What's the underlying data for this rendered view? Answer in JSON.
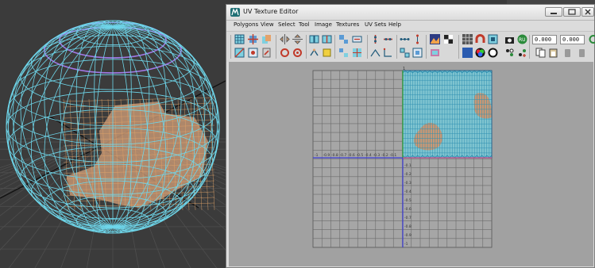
{
  "window": {
    "title": "UV Texture Editor",
    "minimize_icon": "minimize-icon",
    "maximize_icon": "maximize-icon",
    "close_icon": "close-icon"
  },
  "menu": [
    "Polygons",
    "View",
    "Select",
    "Tool",
    "Image",
    "Textures",
    "UV Sets",
    "Help"
  ],
  "toolbar": {
    "u_value": "0.000",
    "v_value": "0.000"
  },
  "grid": {
    "top_axis_label": "1",
    "h_axis_labels": [
      "-1",
      "-0.9",
      "-0.8",
      "-0.7",
      "-0.6",
      "-0.5",
      "-0.4",
      "-0.3",
      "-0.2",
      "-0.1"
    ],
    "v_axis_labels": [
      "-0.1",
      "-0.2",
      "-0.3",
      "-0.4",
      "-0.5",
      "-0.6",
      "-0.7",
      "-0.8",
      "-0.9",
      "-1"
    ]
  },
  "colors": {
    "wire_cyan": "#6ed6ea",
    "wire_purple": "#a279e8",
    "wire_orange": "#e3a56a",
    "texture_patch": "#c89875",
    "grid_background": "#a1a1a1",
    "axis_blue": "#3c3cd8"
  }
}
